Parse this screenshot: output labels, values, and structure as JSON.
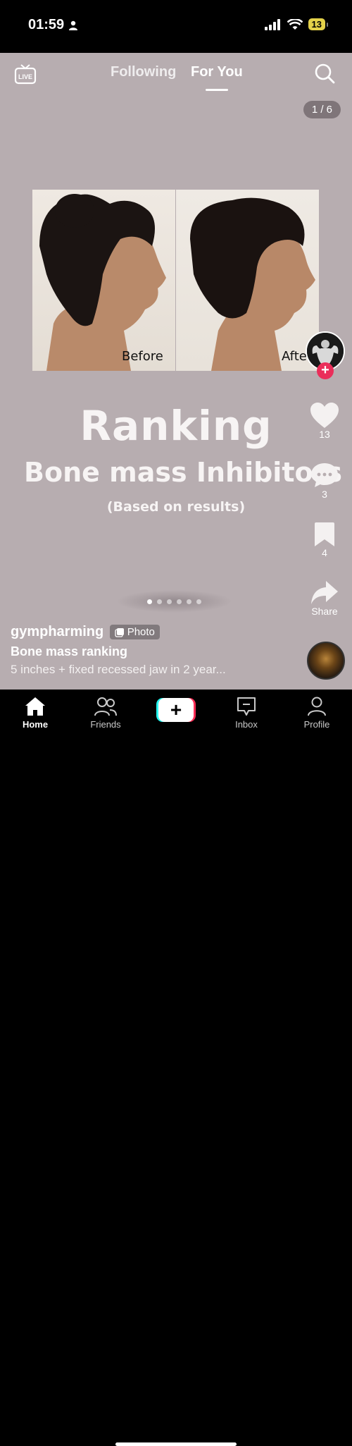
{
  "status": {
    "time": "01:59",
    "battery": "13"
  },
  "nav": {
    "live": "LIVE",
    "following": "Following",
    "for_you": "For You",
    "page_counter": "1 / 6"
  },
  "post": {
    "photo_labels": {
      "before": "Before",
      "after": "Afte"
    },
    "heading": "Ranking",
    "subheading": "Bone mass Inhibitors",
    "note": "(Based on results)",
    "carousel_total": 6,
    "carousel_active": 1
  },
  "actions": {
    "likes": "13",
    "comments": "3",
    "saves": "4",
    "share": "Share"
  },
  "caption": {
    "username": "gympharming",
    "badge": "Photo",
    "title": "Bone mass ranking",
    "description": "5 inches + fixed recessed jaw in 2 year..."
  },
  "tabbar": {
    "home": "Home",
    "friends": "Friends",
    "create": "+",
    "inbox": "Inbox",
    "profile": "Profile"
  },
  "colors": {
    "feed_bg": "#b7adb0",
    "like_red": "#ea2e5a",
    "accent_cyan": "#25f4ee",
    "accent_pink": "#fe2c55"
  }
}
